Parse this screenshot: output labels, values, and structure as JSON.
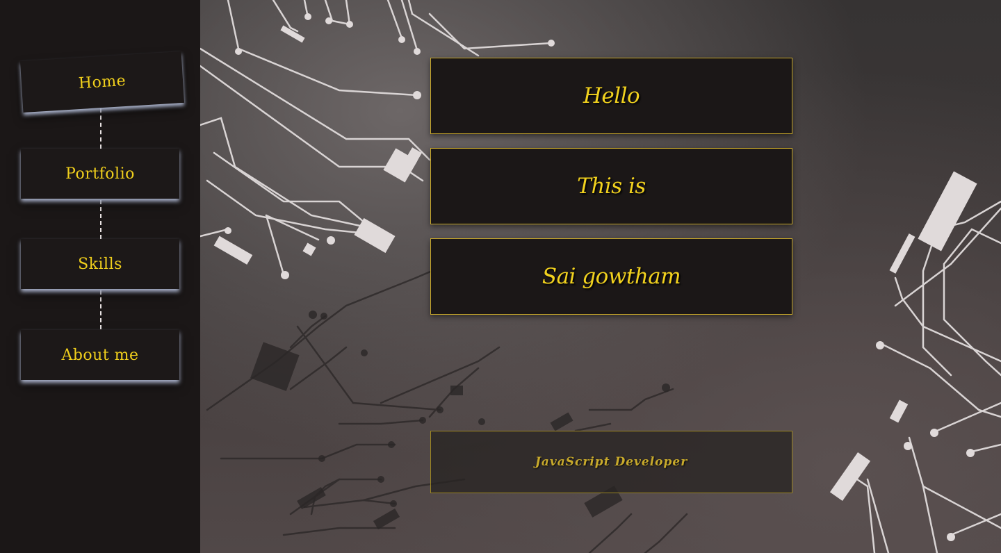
{
  "sidebar": {
    "items": [
      {
        "label": "Home",
        "active": true
      },
      {
        "label": "Portfolio",
        "active": false
      },
      {
        "label": "Skills",
        "active": false
      },
      {
        "label": "About me",
        "active": false
      }
    ]
  },
  "hero": {
    "lines": [
      "Hello",
      "This is",
      "Sai gowtham"
    ]
  },
  "role": {
    "title": "JavaScript Developer"
  },
  "colors": {
    "accent": "#f2d21e",
    "sidebar_bg": "#1b1717",
    "box_border": "#c8a82a"
  }
}
